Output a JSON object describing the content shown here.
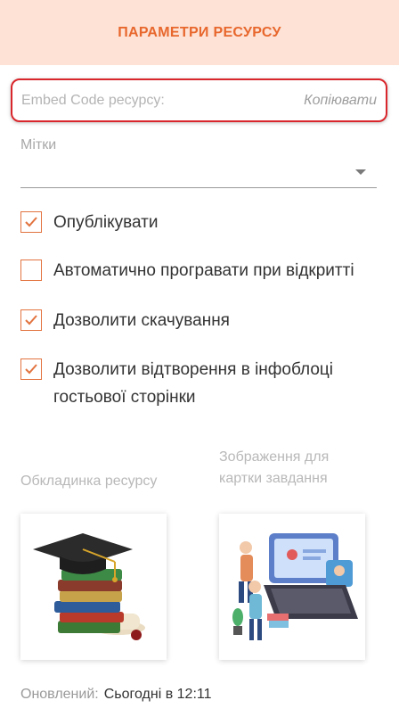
{
  "header": {
    "title": "ПАРАМЕТРИ РЕСУРСУ"
  },
  "embed": {
    "label": "Embed Code ресурсу:",
    "copy_label": "Копіювати"
  },
  "tags": {
    "label": "Мітки"
  },
  "options": [
    {
      "label": "Опублікувати",
      "checked": true
    },
    {
      "label": "Автоматично програвати при відкритті",
      "checked": false
    },
    {
      "label": "Дозволити скачування",
      "checked": true
    },
    {
      "label": "Дозволити відтворення в інфоблоці гостьової сторінки",
      "checked": true
    }
  ],
  "cover": {
    "label": "Обкладинка ресурсу"
  },
  "task_image": {
    "label": "Зображення для картки завдання"
  },
  "updated": {
    "label": "Оновлений:",
    "value": "Сьогодні в 12:11"
  },
  "colors": {
    "accent": "#e8672d",
    "header_bg": "#fde2d5",
    "highlight": "#d9262c"
  }
}
